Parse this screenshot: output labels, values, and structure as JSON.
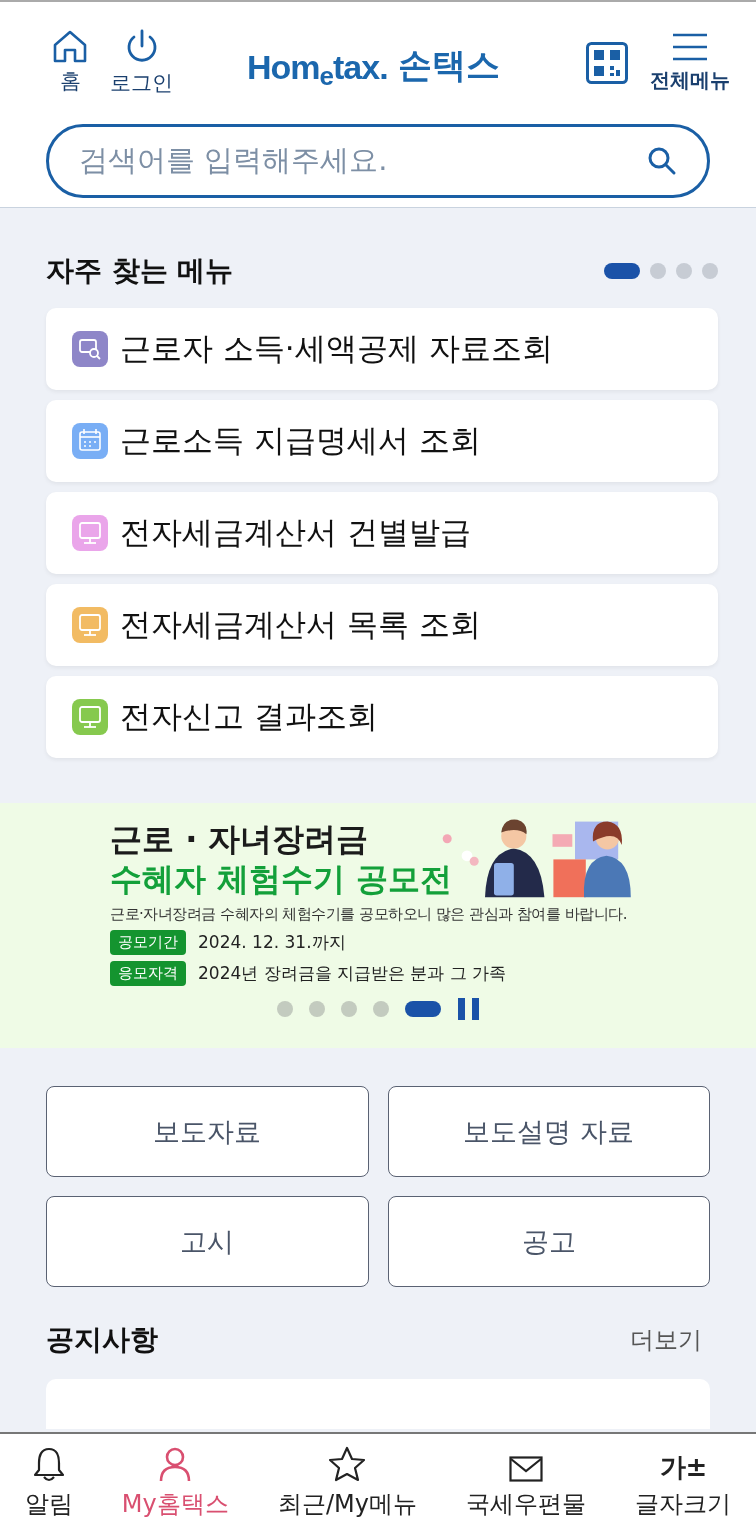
{
  "header": {
    "nav": [
      {
        "label": "홈",
        "kind": "home"
      },
      {
        "label": "로그인",
        "kind": "power"
      }
    ],
    "logo": {
      "brand": "Hom$_{e}$tax.",
      "name": "손택스"
    },
    "menu": {
      "label": "전체메뉴"
    }
  },
  "search": {
    "placeholder": "검색어를 입력해주세요."
  },
  "favorites": {
    "title": "자주 찾는 메뉴",
    "pages": [
      {
        "selected": true
      },
      {
        "selected": false
      },
      {
        "selected": false
      },
      {
        "selected": false
      }
    ],
    "items": [
      {
        "label": "근로자 소득·세액공제 자료조회",
        "kind": "search",
        "color": "#8e86c8"
      },
      {
        "label": "근로소득 지급명세서 조회",
        "kind": "calendar",
        "color": "#79aef5"
      },
      {
        "label": "전자세금계산서 건별발급",
        "kind": "monitor",
        "color": "#eaa5ea"
      },
      {
        "label": "전자세금계산서 목록 조회",
        "kind": "monitor",
        "color": "#f2bb63"
      },
      {
        "label": "전자신고 결과조회",
        "kind": "monitor",
        "color": "#86c94e"
      }
    ]
  },
  "banner": {
    "title": "근로 · 자녀장려금",
    "subtitle": "수혜자 체험수기 공모전",
    "description": "근로·자녀장려금 수혜자의 체험수기를 공모하오니 많은 관심과 참여를 바랍니다.",
    "details": [
      {
        "tag": "공모기간",
        "text": "2024. 12. 31.까지"
      },
      {
        "tag": "응모자격",
        "text": "2024년 장려금을 지급받은 분과 그 가족"
      }
    ],
    "pages": [
      {
        "selected": false
      },
      {
        "selected": false
      },
      {
        "selected": false
      },
      {
        "selected": false
      },
      {
        "selected": true
      }
    ]
  },
  "links": [
    "보도자료",
    "보도설명 자료",
    "고시",
    "공고"
  ],
  "notices": {
    "title": "공지사항",
    "more": "더보기"
  },
  "bottom_nav": [
    {
      "label": "알림",
      "kind": "bell",
      "selected": false
    },
    {
      "label": "My홈택스",
      "kind": "person",
      "selected": true
    },
    {
      "label": "최근/My메뉴",
      "kind": "star",
      "selected": false
    },
    {
      "label": "국세우편물",
      "kind": "mail",
      "selected": false
    },
    {
      "label": "글자크기",
      "kind": "fontsize",
      "glyph": "가±",
      "selected": false
    }
  ]
}
